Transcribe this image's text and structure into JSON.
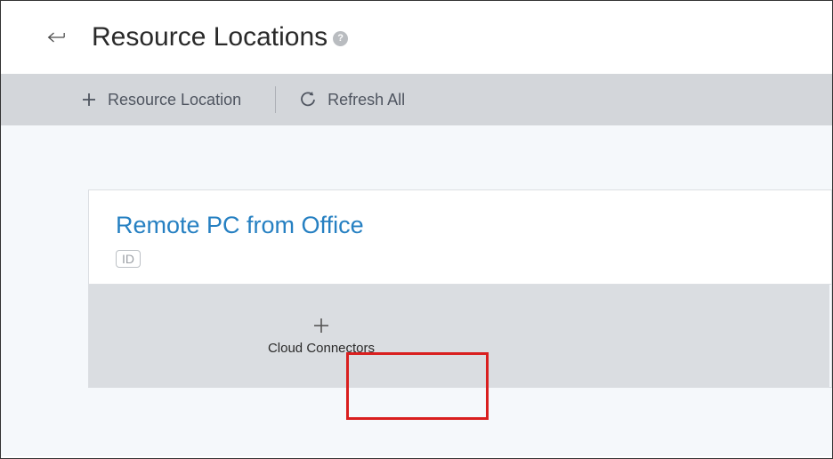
{
  "header": {
    "title": "Resource Locations",
    "help_glyph": "?"
  },
  "toolbar": {
    "add_label": "Resource Location",
    "refresh_label": "Refresh All"
  },
  "card": {
    "title": "Remote PC from Office",
    "id_badge": "ID",
    "action_label": "Cloud Connectors"
  }
}
